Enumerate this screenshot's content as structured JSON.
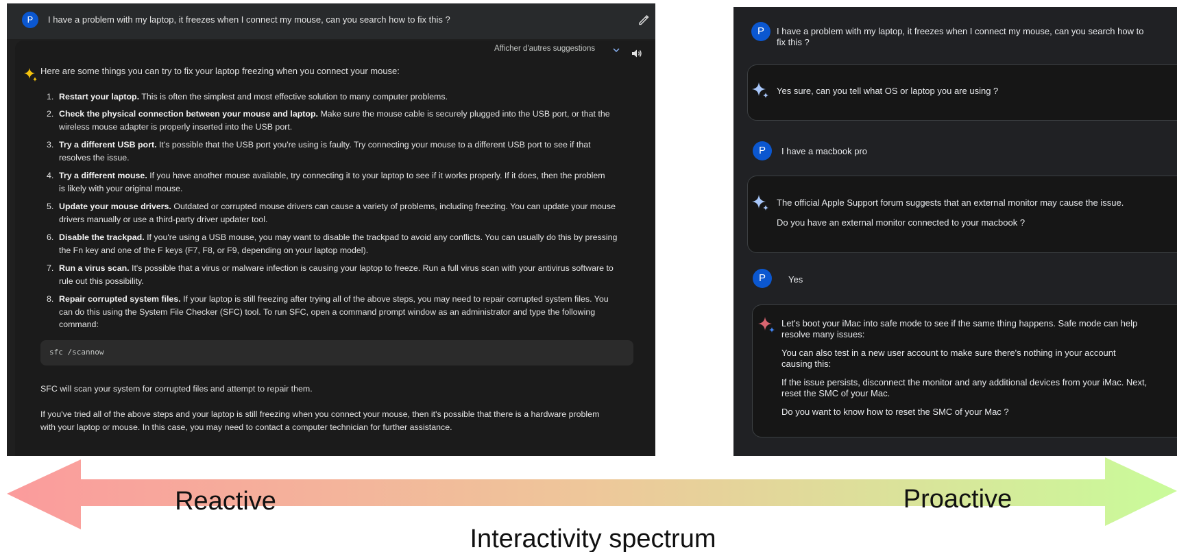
{
  "left": {
    "user_initial": "P",
    "question": "I have a problem with my laptop, it freezes when I connect my mouse, can you search how to fix this ?",
    "suggestions_label": "Afficher d'autres suggestions",
    "intro": "Here are some things you can try to fix your laptop freezing when you connect your mouse:",
    "steps": [
      {
        "num": "1.",
        "title": "Restart your laptop.",
        "line1": " This is often the simplest and most effective solution to many computer problems.",
        "line2": "",
        "line3": ""
      },
      {
        "num": "2.",
        "title": "Check the physical connection between your mouse and laptop.",
        "line1": " Make sure the mouse cable is securely plugged into the USB port, or that the",
        "line2": "wireless mouse adapter is properly inserted into the USB port.",
        "line3": ""
      },
      {
        "num": "3.",
        "title": "Try a different USB port.",
        "line1": " It's possible that the USB port you're using is faulty. Try connecting your mouse to a different USB port to see if that",
        "line2": "resolves the issue.",
        "line3": ""
      },
      {
        "num": "4.",
        "title": "Try a different mouse.",
        "line1": " If you have another mouse available, try connecting it to your laptop to see if it works properly. If it does, then the problem",
        "line2": "is likely with your original mouse.",
        "line3": ""
      },
      {
        "num": "5.",
        "title": "Update your mouse drivers.",
        "line1": " Outdated or corrupted mouse drivers can cause a variety of problems, including freezing. You can update your mouse",
        "line2": "drivers manually or use a third-party driver updater tool.",
        "line3": ""
      },
      {
        "num": "6.",
        "title": "Disable the trackpad.",
        "line1": " If you're using a USB mouse, you may want to disable the trackpad to avoid any conflicts. You can usually do this by pressing",
        "line2": "the Fn key and one of the F keys (F7, F8, or F9, depending on your laptop model).",
        "line3": ""
      },
      {
        "num": "7.",
        "title": "Run a virus scan.",
        "line1": " It's possible that a virus or malware infection is causing your laptop to freeze. Run a full virus scan with your antivirus software to",
        "line2": "rule out this possibility.",
        "line3": ""
      },
      {
        "num": "8.",
        "title": "Repair corrupted system files.",
        "line1": " If your laptop is still freezing after trying all of the above steps, you may need to repair corrupted system files. You",
        "line2": "can do this using the System File Checker (SFC) tool. To run SFC, open a command prompt window as an administrator and type the following",
        "line3": "command:"
      }
    ],
    "code": "sfc /scannow",
    "para1": "SFC will scan your system for corrupted files and attempt to repair them.",
    "para2_line1": "If you've tried all of the above steps and your laptop is still freezing when you connect your mouse, then it's possible that there is a hardware problem",
    "para2_line2": "with your laptop or mouse. In this case, you may need to contact a computer technician for further assistance."
  },
  "right": {
    "user_initial": "P",
    "q1_line1": "I have a problem with my laptop, it freezes when I connect my mouse, can you search how to",
    "q1_line2": "fix this ?",
    "a1": "Yes sure, can you tell what OS or laptop you are using ?",
    "q2": "I have a macbook pro",
    "a2_line1": "The official Apple Support forum suggests that an external monitor may cause the issue.",
    "a2_line2": "Do you have an external monitor connected to your macbook ?",
    "q3": "Yes",
    "a3_p1_line1": "Let's boot your iMac into safe mode to see if the same thing happens. Safe mode can help",
    "a3_p1_line2": "resolve many issues:",
    "a3_p2_line1": "You can also test in a new user account to make sure there's nothing in your account",
    "a3_p2_line2": "causing this:",
    "a3_p3_line1": "If the issue persists, disconnect the monitor and any additional devices from your iMac. Next,",
    "a3_p3_line2": "reset the SMC of your Mac.",
    "a3_p4": "Do you want to know how to reset the SMC of your Mac ?"
  },
  "spectrum": {
    "left_label": "Reactive",
    "right_label": "Proactive",
    "caption": "Interactivity spectrum",
    "gradient_start": "#fb9b9c",
    "gradient_mid": "#eec79a",
    "gradient_end": "#c9fb9a"
  },
  "colors": {
    "avatar": "#0b57d0",
    "panel_dark": "#1f1f1f",
    "header_dark": "#282a2c"
  }
}
